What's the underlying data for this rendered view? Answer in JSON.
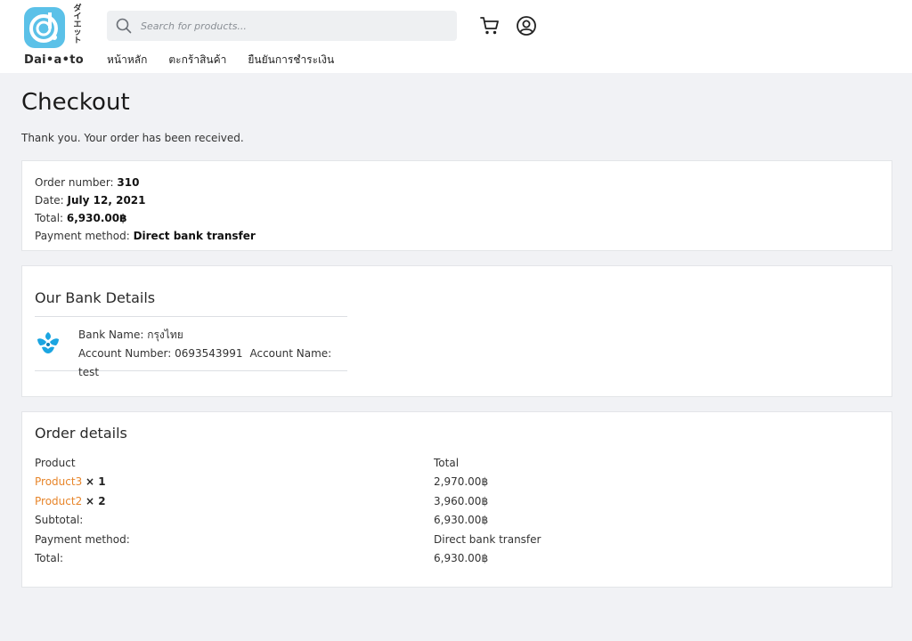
{
  "header": {
    "logo_text": "Dai•a•to",
    "logo_kana": "ダイエット",
    "search_placeholder": "Search for products...",
    "nav": [
      {
        "label": "หน้าหลัก"
      },
      {
        "label": "ตะกร้าสินค้า"
      },
      {
        "label": "ยืนยันการชำระเงิน"
      }
    ]
  },
  "page": {
    "title": "Checkout",
    "thanks": "Thank you. Your order has been received."
  },
  "summary": {
    "order_number_label": "Order number: ",
    "order_number": "310",
    "date_label": "Date: ",
    "date": "July 12, 2021",
    "total_label": "Total: ",
    "total": "6,930.00฿",
    "payment_label": "Payment method: ",
    "payment": "Direct bank transfer"
  },
  "bank": {
    "title": "Our Bank Details",
    "bank_name_label": "Bank Name: ",
    "bank_name": "กรุงไทย",
    "account_number_label": "Account Number: ",
    "account_number": "0693543991",
    "account_name_label": "Account Name: ",
    "account_name": "test"
  },
  "order": {
    "title": "Order details",
    "col_product": "Product",
    "col_total": "Total",
    "items": [
      {
        "name": "Product3",
        "qty": "× 1",
        "total": "2,970.00฿"
      },
      {
        "name": "Product2",
        "qty": "× 2",
        "total": "3,960.00฿"
      }
    ],
    "subtotal_label": "Subtotal:",
    "subtotal": "6,930.00฿",
    "payment_label": "Payment method:",
    "payment": "Direct bank transfer",
    "total_label": "Total:",
    "total": "6,930.00฿"
  },
  "colors": {
    "accent": "#e7852a",
    "logo": "#5bc1e8",
    "background": "#f1f2f5"
  }
}
